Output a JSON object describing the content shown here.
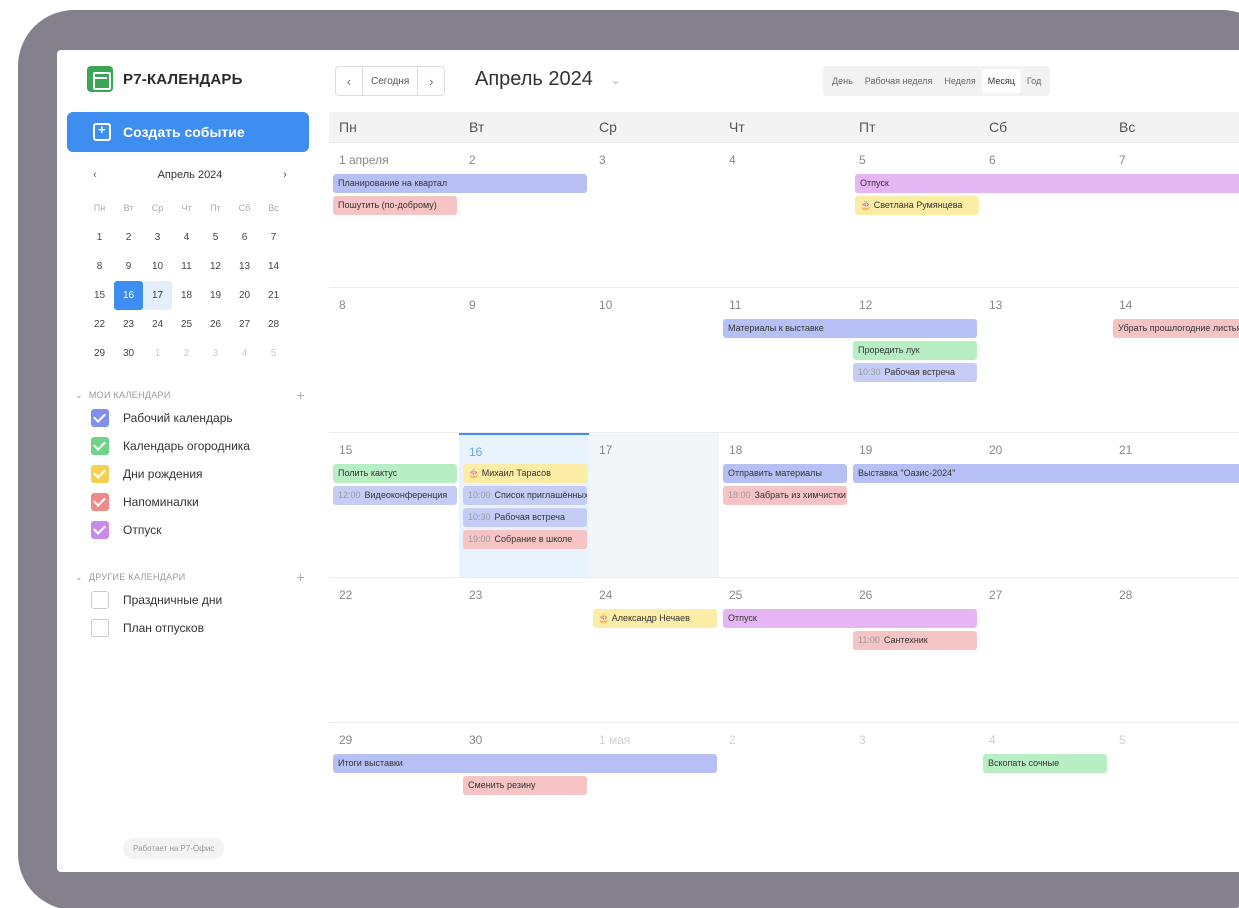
{
  "app": {
    "title": "Р7-КАЛЕНДАРЬ",
    "create_label": "Создать событие",
    "powered": "Работает на Р7-Офис"
  },
  "mini_calendar": {
    "title": "Апрель 2024",
    "weekdays": [
      "Пн",
      "Вт",
      "Ср",
      "Чт",
      "Пт",
      "Сб",
      "Вс"
    ],
    "days": [
      "1",
      "2",
      "3",
      "4",
      "5",
      "6",
      "7",
      "8",
      "9",
      "10",
      "11",
      "12",
      "13",
      "14",
      "15",
      "16",
      "17",
      "18",
      "19",
      "20",
      "21",
      "22",
      "23",
      "24",
      "25",
      "26",
      "27",
      "28",
      "29",
      "30",
      "1",
      "2",
      "3",
      "4",
      "5"
    ]
  },
  "my_calendars": {
    "title": "МОИ КАЛЕНДАРИ",
    "items": [
      {
        "label": "Рабочий календарь",
        "color": "#7f8ff0"
      },
      {
        "label": "Календарь огородника",
        "color": "#6fd388"
      },
      {
        "label": "Дни рождения",
        "color": "#f7cf50"
      },
      {
        "label": "Напоминалки",
        "color": "#ef8a8a"
      },
      {
        "label": "Отпуск",
        "color": "#c98ae8"
      }
    ]
  },
  "other_calendars": {
    "title": "ДРУГИЕ КАЛЕНДАРИ",
    "items": [
      {
        "label": "Праздничные дни"
      },
      {
        "label": "План отпусков"
      }
    ]
  },
  "toolbar": {
    "today": "Сегодня",
    "month": "Апрель 2024",
    "views": [
      "День",
      "Рабочая неделя",
      "Неделя",
      "Месяц",
      "Год"
    ]
  },
  "weekdays": [
    "Пн",
    "Вт",
    "Ср",
    "Чт",
    "Пт",
    "Сб",
    "Вс"
  ],
  "weeks": [
    [
      "1 апреля",
      "2",
      "3",
      "4",
      "5",
      "6",
      "7"
    ],
    [
      "8",
      "9",
      "10",
      "11",
      "12",
      "13",
      "14"
    ],
    [
      "15",
      "16",
      "17",
      "18",
      "19",
      "20",
      "21"
    ],
    [
      "22",
      "23",
      "24",
      "25",
      "26",
      "27",
      "28"
    ],
    [
      "29",
      "30",
      "1 мая",
      "2",
      "3",
      "4",
      "5"
    ]
  ],
  "events": {
    "w1": {
      "e1": "Планирование на квартал",
      "e2": "Пошутить (по-доброму)",
      "e3": "Отпуск",
      "e4": "Светлана Румянцева"
    },
    "w2": {
      "e1": "Материалы к выставке",
      "e2": "Убрать прошлогодние листья",
      "e3": "Проредить лук",
      "e4_time": "10:30",
      "e4": "Рабочая встреча"
    },
    "w3": {
      "e1": "Полить кактус",
      "e2_time": "12:00",
      "e2": "Видеоконференция",
      "e3": "Михаил Тарасов",
      "e4_time": "10:00",
      "e4": "Список приглашённых",
      "e5_time": "10:30",
      "e5": "Рабочая встреча",
      "e6_time": "19:00",
      "e6": "Собрание в школе",
      "e7": "Отправить материалы",
      "e8_time": "18:00",
      "e8": "Забрать из химчистки",
      "e9": "Выставка \"Оазис-2024\""
    },
    "w4": {
      "e1": "Александр Нечаев",
      "e2": "Отпуск",
      "e3_time": "11:00",
      "e3": "Сантехник"
    },
    "w5": {
      "e1": "Итоги выставки",
      "e2": "Сменить резину",
      "e3": "Вскопать сочные"
    }
  }
}
